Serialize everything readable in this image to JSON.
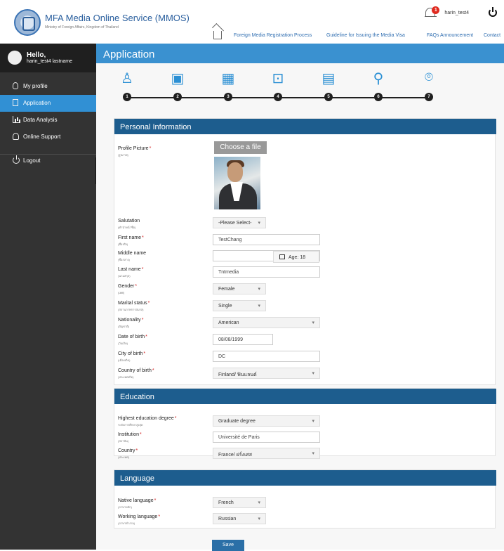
{
  "header": {
    "title": "MFA Media Online Service (MMOS)",
    "subtitle": "Ministry of Foreign Affairs, Kingdom of Thailand",
    "notification_count": "1",
    "username": "harin_test4",
    "nav": [
      "Foreign Media Registration Process",
      "Guideline for Issuing the Media Visa",
      "FAQs",
      "Announcement",
      "Contact"
    ]
  },
  "sidebar": {
    "hello": "Hello,",
    "user": "harin_test4 lastname",
    "items": [
      "My profile",
      "Application",
      "Data Analysis",
      "Online Support",
      "Logout"
    ],
    "collapse": "<"
  },
  "page": {
    "title": "Application",
    "steps": [
      "1",
      "2",
      "3",
      "4",
      "5",
      "6",
      "7"
    ]
  },
  "personal": {
    "title": "Personal Information",
    "profile_picture": "Profile Picture",
    "profile_picture_sub": "(รูปภาพ)",
    "choose_file": "Choose a file",
    "salutation": "Salutation",
    "salutation_sub": "(คำนำหน้าชื่อ)",
    "salutation_value": "-Please Select-",
    "first_name": "First name",
    "first_name_sub": "(ชื่อจริง)",
    "first_name_value": "TestChang",
    "middle_name": "Middle name",
    "middle_name_sub": "(ชื่อกลาง)",
    "last_name": "Last name",
    "last_name_sub": "(นามสกุล)",
    "last_name_value": "Tntmedia",
    "gender": "Gender",
    "gender_sub": "(เพศ)",
    "gender_value": "Female",
    "marital": "Marital status",
    "marital_sub": "(สถานภาพการสมรส)",
    "marital_value": "Single",
    "nationality": "Nationality",
    "nationality_sub": "(สัญชาติ)",
    "nationality_value": "American",
    "dob": "Date of birth",
    "dob_sub": "(วันเกิด)",
    "dob_value": "08/08/1999",
    "age": "Age: 18",
    "city": "City of birth",
    "city_sub": "(เมืองเกิด)",
    "city_value": "DC",
    "country": "Country of birth",
    "country_sub": "(ประเทศเกิด)",
    "country_value": "Finland/ ฟินแลนด์"
  },
  "education": {
    "title": "Education",
    "degree": "Highest education degree",
    "degree_sub": "ระดับการศึกษาสูงสุด",
    "degree_value": "Graduate degree",
    "institution": "Institution",
    "institution_sub": "(สถาบัน)",
    "institution_value": "Université de Paris",
    "country": "Country",
    "country_sub": "(ประเทศ)",
    "country_value": "France/ ฝรั่งเศส"
  },
  "language": {
    "title": "Language",
    "native": "Native language",
    "native_sub": "(ภาษาหลัก)",
    "native_value": "French",
    "working": "Working language",
    "working_sub": "(ภาษาทำงาน)",
    "working_value": "Russian"
  },
  "actions": {
    "save": "Save"
  }
}
